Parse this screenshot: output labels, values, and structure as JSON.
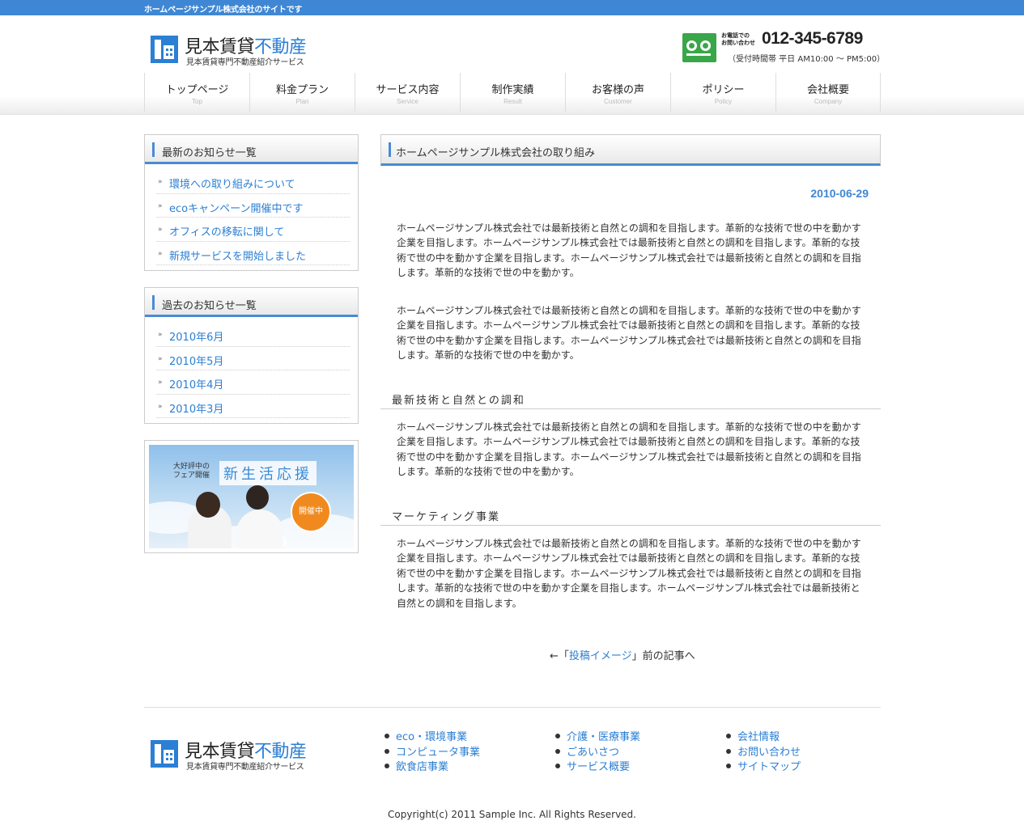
{
  "topbar": {
    "text": "ホームページサンプル株式会社のサイトです"
  },
  "header": {
    "logo_title_main": "見本賃貸",
    "logo_title_accent": "不動産",
    "logo_subtitle": "見本賃貸専門不動産紹介サービス",
    "phone_label_line1": "お電話での",
    "phone_label_line2": "お問い合わせ",
    "phone_number": "012-345-6789",
    "phone_hours": "（受付時間帯 平日 AM10:00 〜 PM5:00）"
  },
  "nav": {
    "items": [
      {
        "label": "トップページ",
        "sub": "Top"
      },
      {
        "label": "料金プラン",
        "sub": "Plan"
      },
      {
        "label": "サービス内容",
        "sub": "Service"
      },
      {
        "label": "制作実績",
        "sub": "Result"
      },
      {
        "label": "お客様の声",
        "sub": "Customer"
      },
      {
        "label": "ポリシー",
        "sub": "Policy"
      },
      {
        "label": "会社概要",
        "sub": "Company"
      }
    ]
  },
  "sidebar": {
    "latest": {
      "title": "最新のお知らせ一覧",
      "items": [
        "環境への取り組みについて",
        "ecoキャンペーン開催中です",
        "オフィスの移転に関して",
        "新規サービスを開始しました"
      ]
    },
    "archive": {
      "title": "過去のお知らせ一覧",
      "items": [
        "2010年6月",
        "2010年5月",
        "2010年4月",
        "2010年3月"
      ]
    },
    "banner": {
      "small_line1": "大好評中の",
      "small_line2": "フェア開催",
      "big": "新生活応援",
      "badge": "開催中"
    }
  },
  "main": {
    "title": "ホームページサンプル株式会社の取り組み",
    "date": "2010-06-29",
    "para1": "ホームページサンプル株式会社では最新技術と自然との調和を目指します。革新的な技術で世の中を動かす企業を目指します。ホームページサンプル株式会社では最新技術と自然との調和を目指します。革新的な技術で世の中を動かす企業を目指します。ホームページサンプル株式会社では最新技術と自然との調和を目指します。革新的な技術で世の中を動かす。",
    "para2": "ホームページサンプル株式会社では最新技術と自然との調和を目指します。革新的な技術で世の中を動かす企業を目指します。ホームページサンプル株式会社では最新技術と自然との調和を目指します。革新的な技術で世の中を動かす企業を目指します。ホームページサンプル株式会社では最新技術と自然との調和を目指します。革新的な技術で世の中を動かす。",
    "subhead1": "最新技術と自然との調和",
    "para3": "ホームページサンプル株式会社では最新技術と自然との調和を目指します。革新的な技術で世の中を動かす企業を目指します。ホームページサンプル株式会社では最新技術と自然との調和を目指します。革新的な技術で世の中を動かす企業を目指します。ホームページサンプル株式会社では最新技術と自然との調和を目指します。革新的な技術で世の中を動かす。",
    "subhead2": "マーケティング事業",
    "para4": "ホームページサンプル株式会社では最新技術と自然との調和を目指します。革新的な技術で世の中を動かす企業を目指します。ホームページサンプル株式会社では最新技術と自然との調和を目指します。革新的な技術で世の中を動かす企業を目指します。ホームページサンプル株式会社では最新技術と自然との調和を目指します。革新的な技術で世の中を動かす企業を目指します。ホームページサンプル株式会社では最新技術と自然との調和を目指します。",
    "prev_prefix": "←「",
    "prev_link": "投稿イメージ",
    "prev_suffix": "」前の記事へ"
  },
  "footer": {
    "col1": [
      "eco・環境事業",
      "コンピュータ事業",
      "飲食店事業"
    ],
    "col2": [
      "介護・医療事業",
      "ごあいさつ",
      "サービス概要"
    ],
    "col3": [
      "会社情報",
      "お問い合わせ",
      "サイトマップ"
    ],
    "copyright": "Copyright(c) 2011 Sample Inc. All Rights Reserved."
  },
  "colors": {
    "accent": "#3f87d4",
    "link": "#2b7fd4",
    "badge": "#f18a1e",
    "phone_badge": "#3aa64a"
  }
}
